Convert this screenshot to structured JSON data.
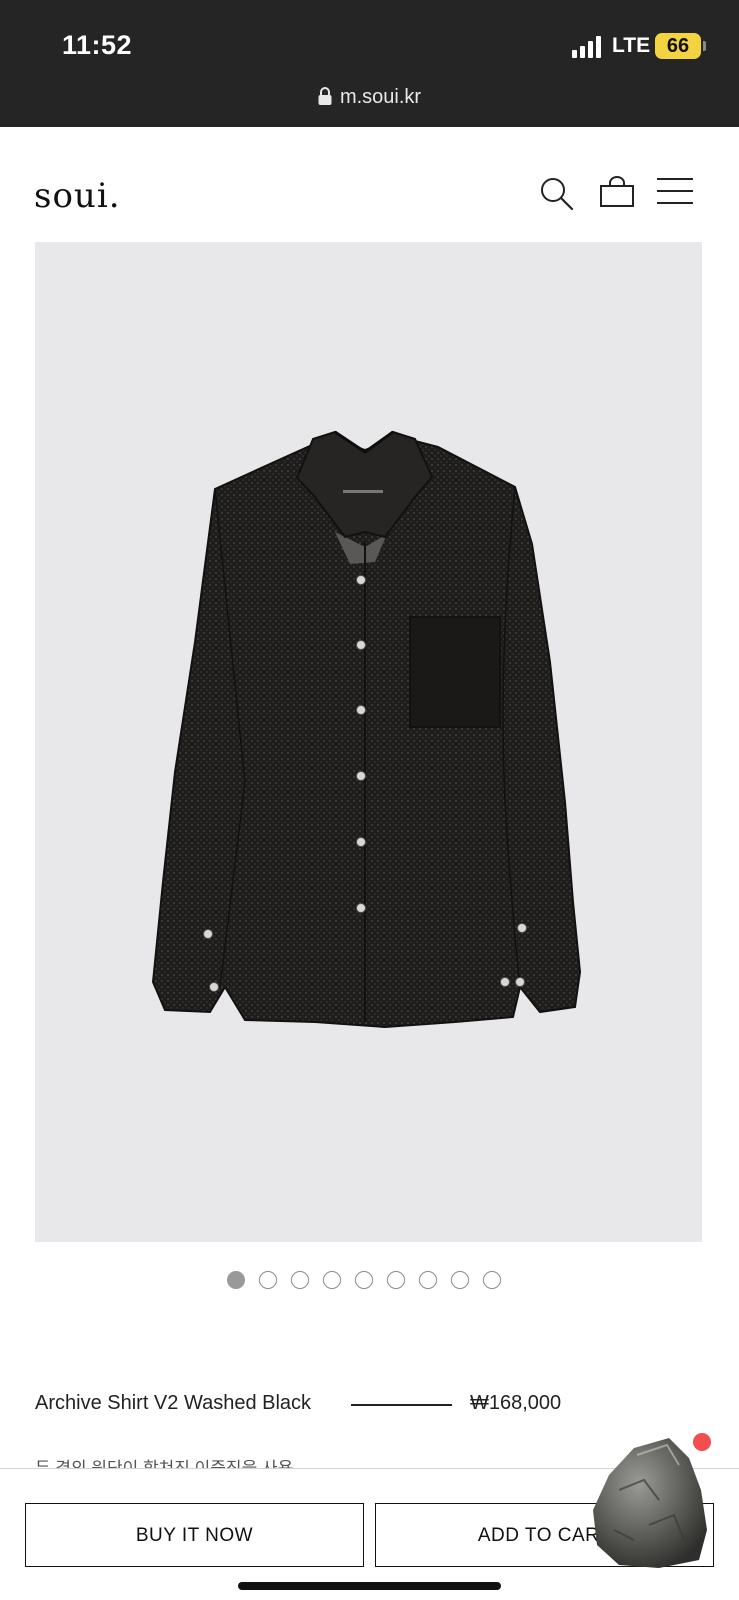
{
  "status_bar": {
    "time": "11:52",
    "carrier": "LTE",
    "battery": "66",
    "url": "m.soui.kr",
    "battery_color": "#f3d33f"
  },
  "header": {
    "logo": "soui.",
    "icons": [
      "search-icon",
      "shopping-bag-icon",
      "menu-icon"
    ]
  },
  "product": {
    "image_background": "#e8e8eb",
    "carousel": {
      "total": 9,
      "active_index": 0
    },
    "title": "Archive Shirt V2 Washed Black",
    "price": "₩168,000",
    "description": "두 겹의 원단이 합쳐진 이중직을 사용"
  },
  "actions": {
    "buy_now_label": "BUY IT NOW",
    "add_to_cart_label": "ADD TO CART"
  },
  "floating_widget": {
    "notification_color": "#f24e4e"
  }
}
